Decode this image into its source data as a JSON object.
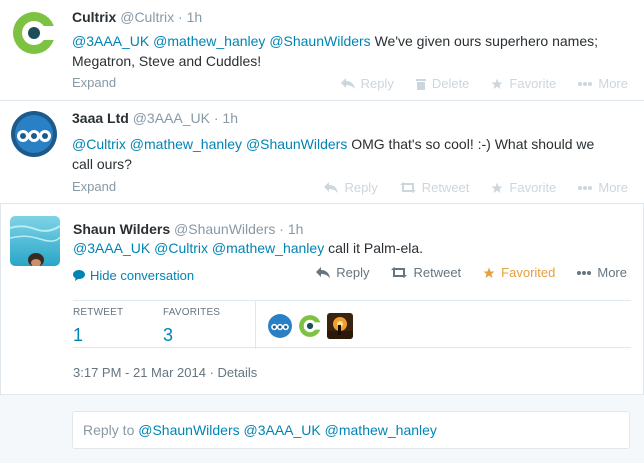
{
  "tweets": [
    {
      "name": "Cultrix",
      "handle": "@Cultrix",
      "time": "1h",
      "mentions": [
        "@3AAA_UK",
        "@mathew_hanley",
        "@ShaunWilders"
      ],
      "text_after": " We've given ours superhero names;",
      "text_line2": "Megatron, Steve and Cuddles!",
      "expand": "Expand",
      "actions": {
        "reply": "Reply",
        "delete": "Delete",
        "favorite": "Favorite",
        "more": "More"
      }
    },
    {
      "name": "3aaa Ltd",
      "handle": "@3AAA_UK",
      "time": "1h",
      "mentions": [
        "@Cultrix",
        "@mathew_hanley",
        "@ShaunWilders"
      ],
      "text_after": " OMG that's so cool! :-) What should we",
      "text_line2": "call ours?",
      "expand": "Expand",
      "actions": {
        "reply": "Reply",
        "retweet": "Retweet",
        "favorite": "Favorite",
        "more": "More"
      }
    },
    {
      "name": "Shaun Wilders",
      "handle": "@ShaunWilders",
      "time": "1h",
      "mentions": [
        "@3AAA_UK",
        "@Cultrix",
        "@mathew_hanley"
      ],
      "text_after": " call it Palm-ela.",
      "hide_conversation": "Hide conversation",
      "actions": {
        "reply": "Reply",
        "retweet": "Retweet",
        "favorited": "Favorited",
        "more": "More"
      },
      "stats": {
        "retweet_label": "RETWEET",
        "retweet_count": "1",
        "favorites_label": "FAVORITES",
        "favorites_count": "3"
      },
      "timestamp": "3:17 PM - 21 Mar 2014",
      "details": "Details"
    }
  ],
  "reply_box": {
    "prefix": "Reply to ",
    "mentions": "@ShaunWilders @3AAA_UK @mathew_hanley"
  },
  "colors": {
    "link": "#0084b4",
    "favorite": "#e5a03b",
    "cultrix_green": "#7dc242"
  }
}
